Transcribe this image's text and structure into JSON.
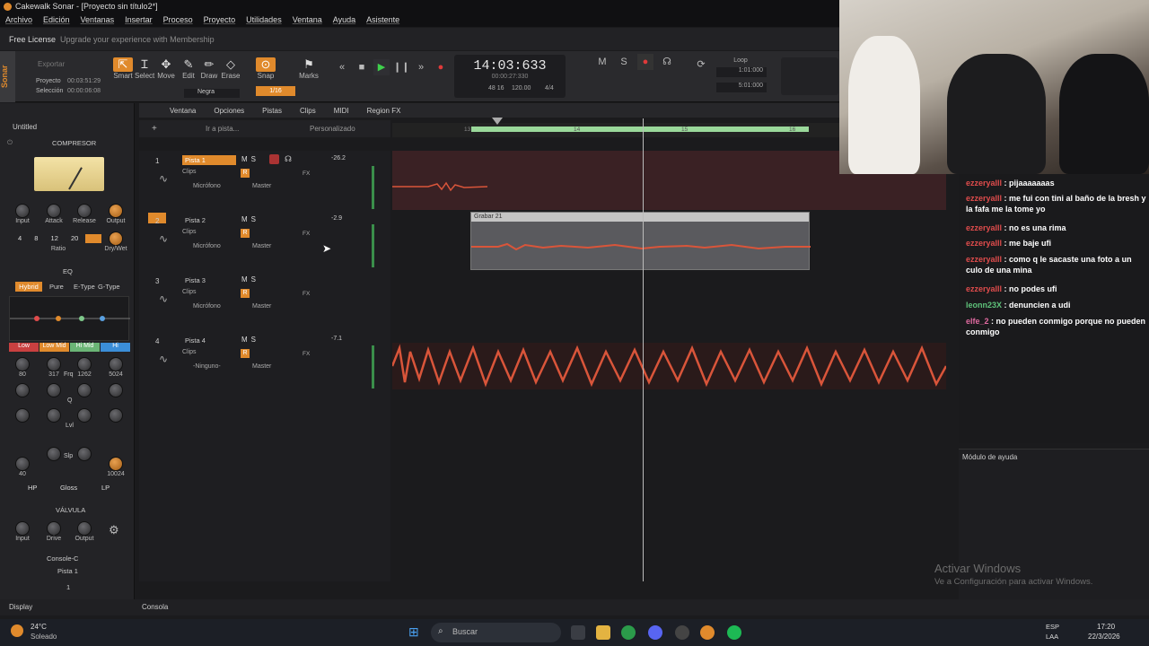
{
  "titlebar": {
    "title": "Cakewalk Sonar - [Proyecto sin título2*]"
  },
  "menu": [
    "Archivo",
    "Edición",
    "Ventanas",
    "Insertar",
    "Proceso",
    "Proyecto",
    "Utilidades",
    "Ventana",
    "Ayuda",
    "Asistente"
  ],
  "license": {
    "label": "Free License",
    "upgrade": "Upgrade your experience with Membership"
  },
  "control": {
    "export": "Exportar",
    "project_label": "Proyecto",
    "project_time": "00:03:51:29",
    "selection_label": "Selección",
    "selection_time": "00:00:06:08",
    "tools": [
      "Smart",
      "Select",
      "Move",
      "Edit",
      "Draw",
      "Erase"
    ],
    "snap": "Snap",
    "snap_value": "1/16",
    "marks": "Marks",
    "negra": "Negra",
    "time_main": "14:03:633",
    "time_sub": "00:00:27:330",
    "tempo": "120.00",
    "meter": "4/4",
    "beats": "48 16",
    "loop_label": "Loop",
    "loop_start": "1:01:000",
    "loop_end": "5:01:000"
  },
  "inspector": {
    "untitled": "Untitled",
    "compressor": {
      "title": "COMPRESOR",
      "knobs": [
        "Input",
        "Attack",
        "Release",
        "Output"
      ],
      "ratios": [
        "4",
        "8",
        "12",
        "20"
      ],
      "ratio_label": "Ratio",
      "drywet": "Dry/Wet"
    },
    "eq": {
      "title": "EQ",
      "modes": [
        "Hybrid",
        "Pure",
        "E-Type",
        "G-Type"
      ],
      "bands": [
        "Low",
        "Low Mid",
        "Hi Mid",
        "Hi"
      ],
      "freqs": [
        "80",
        "317",
        "1262",
        "5024"
      ],
      "frq": "Frq",
      "q": "Q",
      "lvl": "Lvl",
      "slp": "Slp",
      "hp": "HP",
      "gloss": "Gloss",
      "lp": "LP",
      "hpval": "40",
      "lpval": "10024"
    },
    "valvula": {
      "title": "VÁLVULA",
      "knobs": [
        "Input",
        "Drive",
        "Output"
      ]
    },
    "console": {
      "title": "Console-C",
      "track": "Pista 1",
      "value": "1"
    }
  },
  "trackheader": {
    "menus": [
      "Ventana",
      "Opciones",
      "Pistas",
      "Clips",
      "MIDI",
      "Region FX"
    ],
    "goto": "Ir a pista...",
    "preset": "Personalizado"
  },
  "ruler": {
    "marks": [
      "13",
      "14",
      "15",
      "16"
    ]
  },
  "tracks": [
    {
      "num": "1",
      "name": "Pista 1",
      "vol": "-26.2",
      "clips": "Clips",
      "input": "Micrófono",
      "output": "Master"
    },
    {
      "num": "2",
      "name": "Pista 2",
      "vol": "-2.9",
      "clips": "Clips",
      "input": "Micrófono",
      "output": "Master"
    },
    {
      "num": "3",
      "name": "Pista 3",
      "vol": "",
      "clips": "Clips",
      "input": "Micrófono",
      "output": "Master"
    },
    {
      "num": "4",
      "name": "Pista 4",
      "vol": "-7.1",
      "clips": "Clips",
      "input": "-Ninguno-",
      "output": "Master"
    }
  ],
  "clip_label": "Grabar 21",
  "chat": [
    {
      "user": "ezzeryalll",
      "text": "pijaaaaaaas"
    },
    {
      "user": "ezzeryalll",
      "text": "me fui con tini al baño de la bresh y la fafa me la tome yo"
    },
    {
      "user": "ezzeryalll",
      "text": "no es una rima"
    },
    {
      "user": "ezzeryalll",
      "text": "me baje ufi"
    },
    {
      "user": "ezzeryalll",
      "text": "como q le sacaste una foto a un culo de una mina"
    },
    {
      "user": "ezzeryalll",
      "text": "no podes ufi"
    },
    {
      "user": "leonn23X",
      "text": "denuncien a udi"
    },
    {
      "user": "elfe_2",
      "text": "no pueden conmigo porque no pueden conmigo"
    }
  ],
  "help": "Módulo de ayuda",
  "watermark": {
    "line1": "Activar Windows",
    "line2": "Ve a Configuración para activar Windows."
  },
  "bottom": {
    "display": "Display",
    "console": "Consola"
  },
  "taskbar": {
    "temp": "24°C",
    "weather": "Soleado",
    "search": "Buscar",
    "lang1": "ESP",
    "lang2": "LAA",
    "time": "17:20",
    "date": "22/3/2026"
  },
  "colors": {
    "accent": "#e08a2c",
    "wave": "#d9553a",
    "play": "#3fd14c",
    "rec": "#e03a3a"
  }
}
